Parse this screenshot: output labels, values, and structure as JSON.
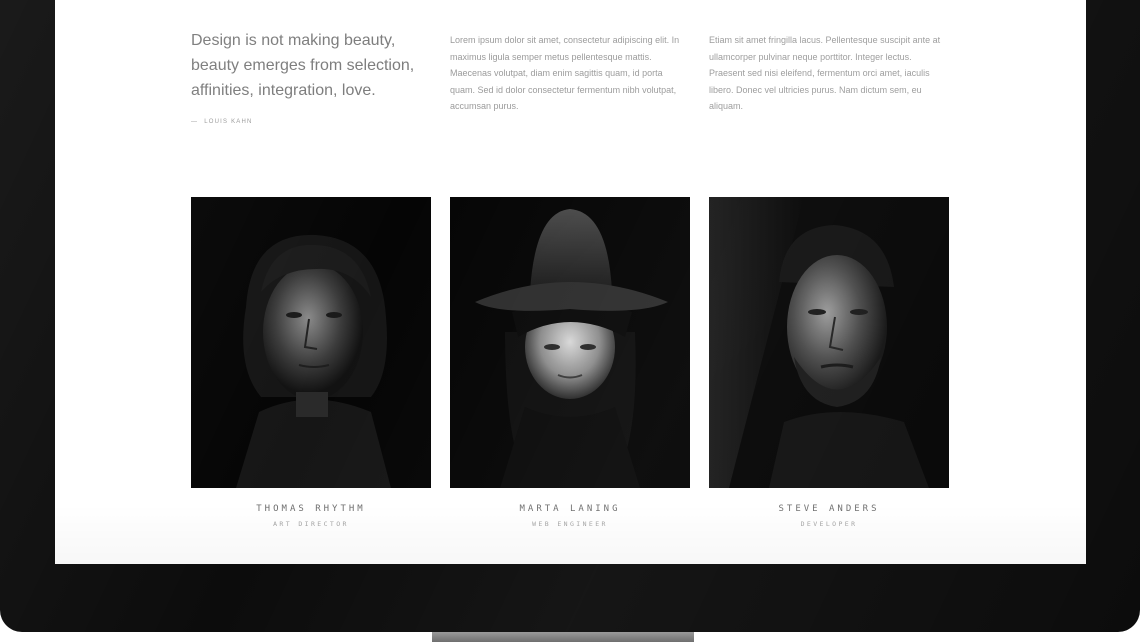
{
  "quote": {
    "text": "Design is not making beauty, beauty emerges from selection, affinities, integration, love.",
    "author": "Louis Kahn"
  },
  "paragraphs": [
    "Lorem ipsum dolor sit amet, consectetur adipiscing elit. In maximus ligula semper metus pellentesque mattis. Maecenas volutpat, diam enim sagittis quam, id porta quam. Sed id dolor consectetur fermentum nibh volutpat, accumsan purus.",
    "Etiam sit amet fringilla lacus. Pellentesque suscipit ante at ullamcorper pulvinar neque porttitor. Integer lectus. Praesent sed nisi eleifend, fermentum orci amet, iaculis libero. Donec vel ultricies purus. Nam dictum sem, eu aliquam."
  ],
  "team": [
    {
      "name": "Thomas Rhythm",
      "role": "Art Director",
      "photo": "portrait-curly-hair-man"
    },
    {
      "name": "Marta Laning",
      "role": "Web Engineer",
      "photo": "portrait-woman-in-hat"
    },
    {
      "name": "Steve Anders",
      "role": "Developer",
      "photo": "portrait-bearded-man"
    }
  ],
  "colors": {
    "monitor_bezel": "#0c0c0c",
    "screen_bg": "#ffffff",
    "text_muted": "#9b9b9b",
    "photo_bg": "#050505"
  }
}
